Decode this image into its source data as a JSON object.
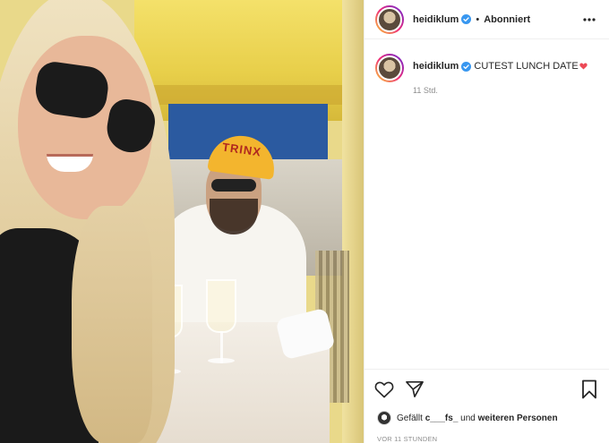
{
  "header": {
    "username": "heidiklum",
    "separator": "•",
    "follow_state": "Abonniert"
  },
  "caption": {
    "username": "heidiklum",
    "text": "CUTEST LUNCH DATE",
    "time_ago": "11 Std."
  },
  "photo": {
    "cap_text": "TRINX"
  },
  "likes": {
    "prefix": "Gefällt ",
    "user": "c___fs_",
    "middle": " und ",
    "others": "weiteren Personen"
  },
  "post_date": "VOR 11 STUNDEN",
  "colors": {
    "verified_badge": "#3897f0",
    "heart_emoji": "#ed4956",
    "divider": "#efefef",
    "muted_text": "#8e8e8e"
  },
  "icons": {
    "more": "more-horizontal-icon",
    "like": "heart-outline-icon",
    "share": "paper-plane-icon",
    "save": "bookmark-icon",
    "verified": "verified-badge-icon"
  }
}
